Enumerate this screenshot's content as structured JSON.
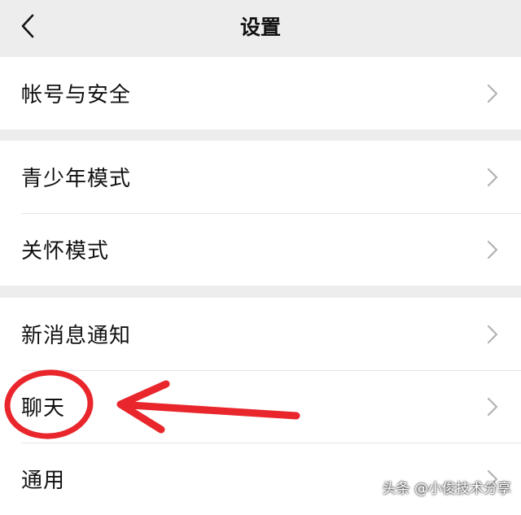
{
  "nav": {
    "title": "设置",
    "back_icon": "chevron-left-icon"
  },
  "groups": [
    {
      "items": [
        {
          "label": "帐号与安全"
        }
      ]
    },
    {
      "items": [
        {
          "label": "青少年模式"
        },
        {
          "label": "关怀模式"
        }
      ]
    },
    {
      "items": [
        {
          "label": "新消息通知"
        },
        {
          "label": "聊天"
        },
        {
          "label": "通用"
        }
      ]
    }
  ],
  "annotation": {
    "color": "#e8262b",
    "highlighted_item": "聊天"
  },
  "watermark": "头条 @小俊技术分享",
  "colors": {
    "background": "#ededed",
    "card": "#ffffff",
    "chevron": "#b2b2b2"
  }
}
